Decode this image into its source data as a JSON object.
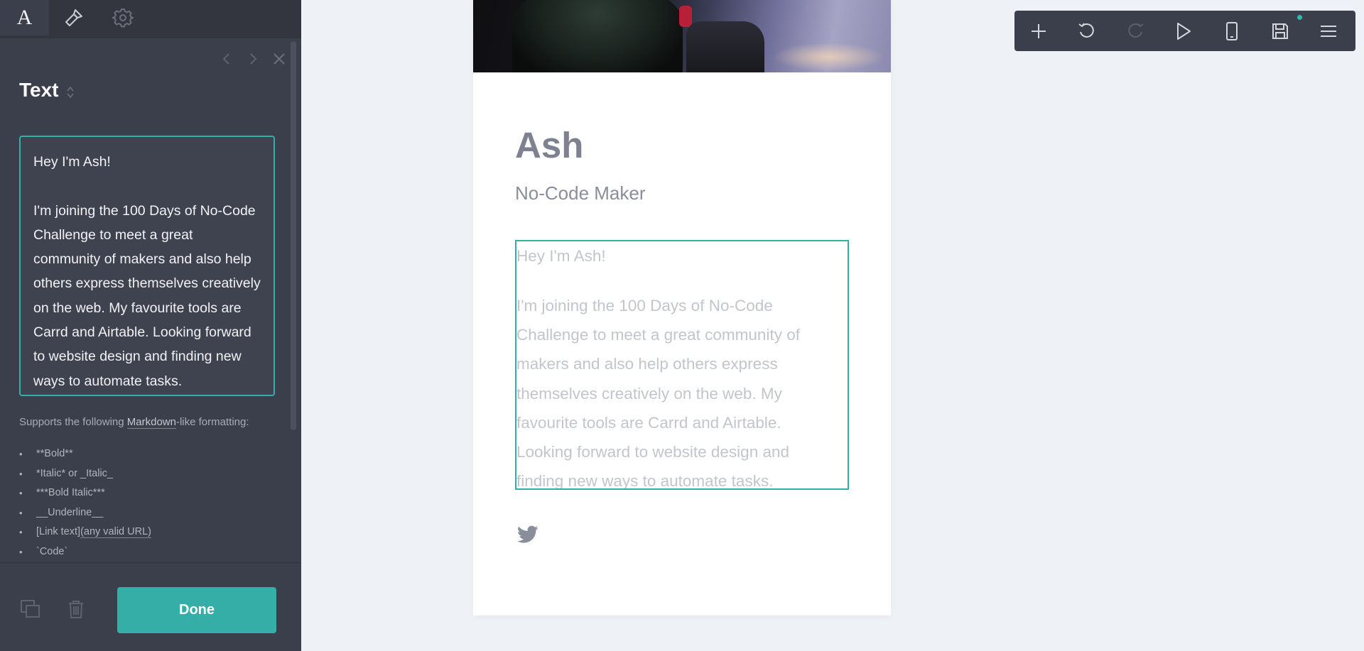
{
  "colors": {
    "accent": "#34aea7",
    "sidebar_bg": "#3b3e4b",
    "canvas_bg": "#eef1f5"
  },
  "sidebar": {
    "tabs": [
      {
        "name": "text-style",
        "label": "A",
        "icon": "text-icon"
      },
      {
        "name": "style",
        "icon": "brush-icon"
      },
      {
        "name": "settings",
        "icon": "gear-icon"
      }
    ],
    "panel_title": "Text",
    "editor_value": "Hey I'm Ash!\n\nI'm joining the 100 Days of No-Code Challenge to meet a great community of makers and also help others express themselves creatively on the web. My favourite tools are Carrd and Airtable. Looking forward to website design and finding new ways to automate tasks.",
    "help": {
      "prefix": "Supports the following ",
      "link": "Markdown",
      "suffix": "-like formatting:"
    },
    "formats": [
      "**Bold**",
      "*Italic* or _Italic_",
      "***Bold Italic***",
      "__Underline__"
    ],
    "format_link": {
      "label": "[Link text]",
      "url": "(any valid URL)"
    },
    "format_code": "`Code`",
    "done_label": "Done"
  },
  "page": {
    "name": "Ash",
    "tagline": "No-Code Maker",
    "intro": "Hey I'm Ash!",
    "body": "I'm joining the 100 Days of No-Code Challenge to meet a great community of makers and also help others express themselves creatively on the web. My favourite tools are Carrd and Airtable. Looking forward to website design and finding new ways to automate tasks."
  },
  "toolbar": {
    "items": [
      "add-icon",
      "undo-icon",
      "redo-icon",
      "play-icon",
      "mobile-icon",
      "save-icon",
      "menu-icon"
    ]
  }
}
